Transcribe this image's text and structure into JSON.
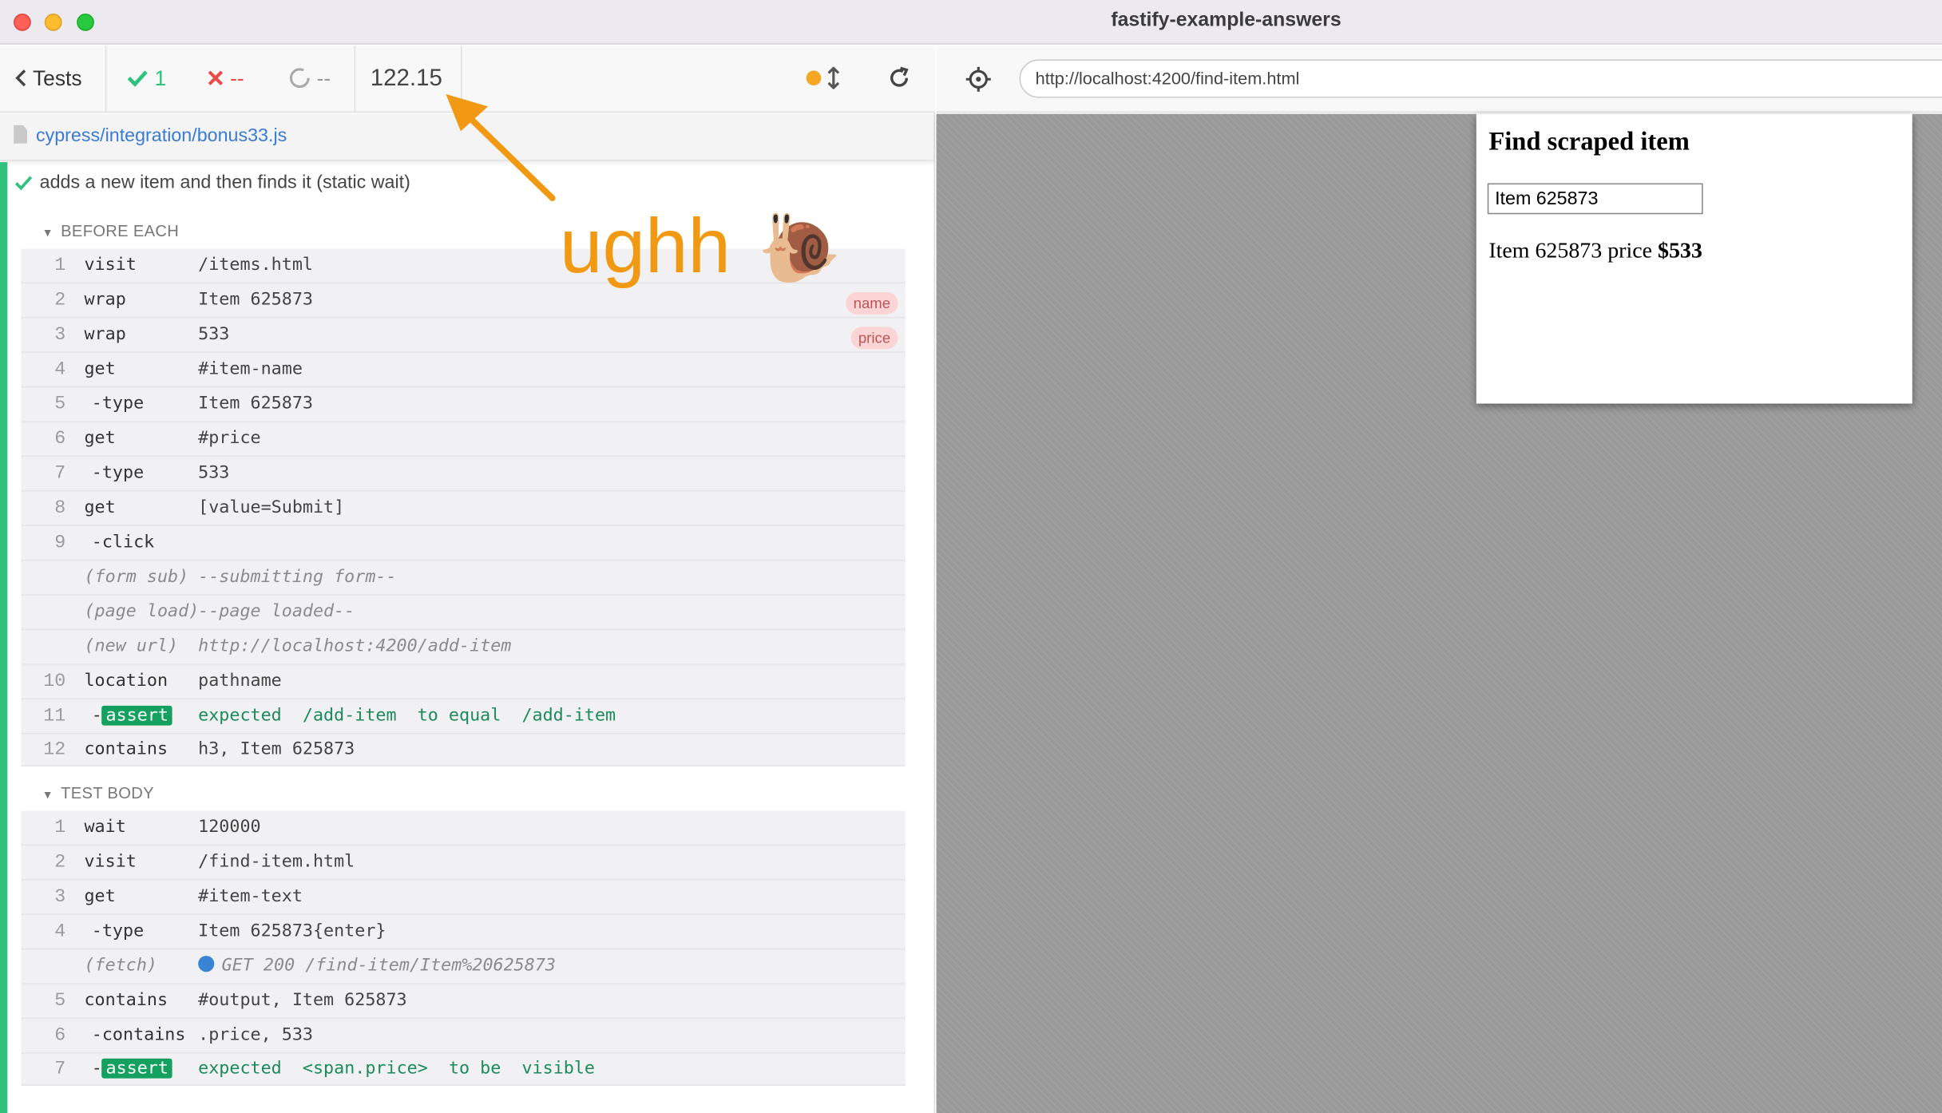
{
  "window": {
    "title": "fastify-example-answers"
  },
  "reporter": {
    "tests_label": "Tests",
    "passed": "1",
    "failed": "--",
    "pending": "--",
    "duration": "122.15",
    "spec_path": "cypress/integration/bonus33.js",
    "test_title": "adds a new item and then finds it (static wait)",
    "before_each_label": "BEFORE EACH",
    "test_body_label": "TEST BODY",
    "before_each": [
      {
        "num": "1",
        "cmd": "visit",
        "msg": "/items.html"
      },
      {
        "num": "2",
        "cmd": "wrap",
        "msg": "Item 625873",
        "badge": "name"
      },
      {
        "num": "3",
        "cmd": "wrap",
        "msg": "533",
        "badge": "price"
      },
      {
        "num": "4",
        "cmd": "get",
        "msg": "#item-name"
      },
      {
        "num": "5",
        "cmd": "-type",
        "msg": "Item 625873"
      },
      {
        "num": "6",
        "cmd": "get",
        "msg": "#price"
      },
      {
        "num": "7",
        "cmd": "-type",
        "msg": "533"
      },
      {
        "num": "8",
        "cmd": "get",
        "msg": "[value=Submit]"
      },
      {
        "num": "9",
        "cmd": "-click",
        "msg": ""
      },
      {
        "num": "",
        "cmd": "(form sub)",
        "msg": "--submitting form--",
        "event": true
      },
      {
        "num": "",
        "cmd": "(page load)",
        "msg": "--page loaded--",
        "event": true
      },
      {
        "num": "",
        "cmd": "(new url)",
        "msg": "http://localhost:4200/add-item",
        "event": true
      },
      {
        "num": "10",
        "cmd": "location",
        "msg": "pathname"
      },
      {
        "num": "11",
        "cmd": "-assert",
        "assert": true,
        "msg_parts": [
          "expected",
          "/add-item",
          "to equal",
          "/add-item"
        ]
      },
      {
        "num": "12",
        "cmd": "contains",
        "msg": "h3, Item 625873"
      }
    ],
    "test_body": [
      {
        "num": "1",
        "cmd": "wait",
        "msg": "120000"
      },
      {
        "num": "2",
        "cmd": "visit",
        "msg": "/find-item.html"
      },
      {
        "num": "3",
        "cmd": "get",
        "msg": "#item-text"
      },
      {
        "num": "4",
        "cmd": "-type",
        "msg": "Item 625873{enter}"
      },
      {
        "num": "",
        "cmd": "(fetch)",
        "msg": "GET 200 /find-item/Item%20625873",
        "event": true,
        "dot": true
      },
      {
        "num": "5",
        "cmd": "contains",
        "msg": "#output, Item 625873"
      },
      {
        "num": "6",
        "cmd": "-contains",
        "msg": ".price, 533"
      },
      {
        "num": "7",
        "cmd": "-assert",
        "assert": true,
        "msg_parts": [
          "expected",
          "<span.price>",
          "to be",
          "visible"
        ]
      }
    ]
  },
  "url_bar": {
    "url": "http://localhost:4200/find-item.html"
  },
  "app": {
    "heading": "Find scraped item",
    "input_value": "Item 625873",
    "output_prefix": "Item 625873 price ",
    "output_price": "$533"
  },
  "annotation": {
    "text": "ughh",
    "emoji": "🐌",
    "color": "#f29913"
  },
  "colors": {
    "pass": "#2ec27e",
    "fail": "#e94b4b",
    "link": "#3a7bd5"
  }
}
